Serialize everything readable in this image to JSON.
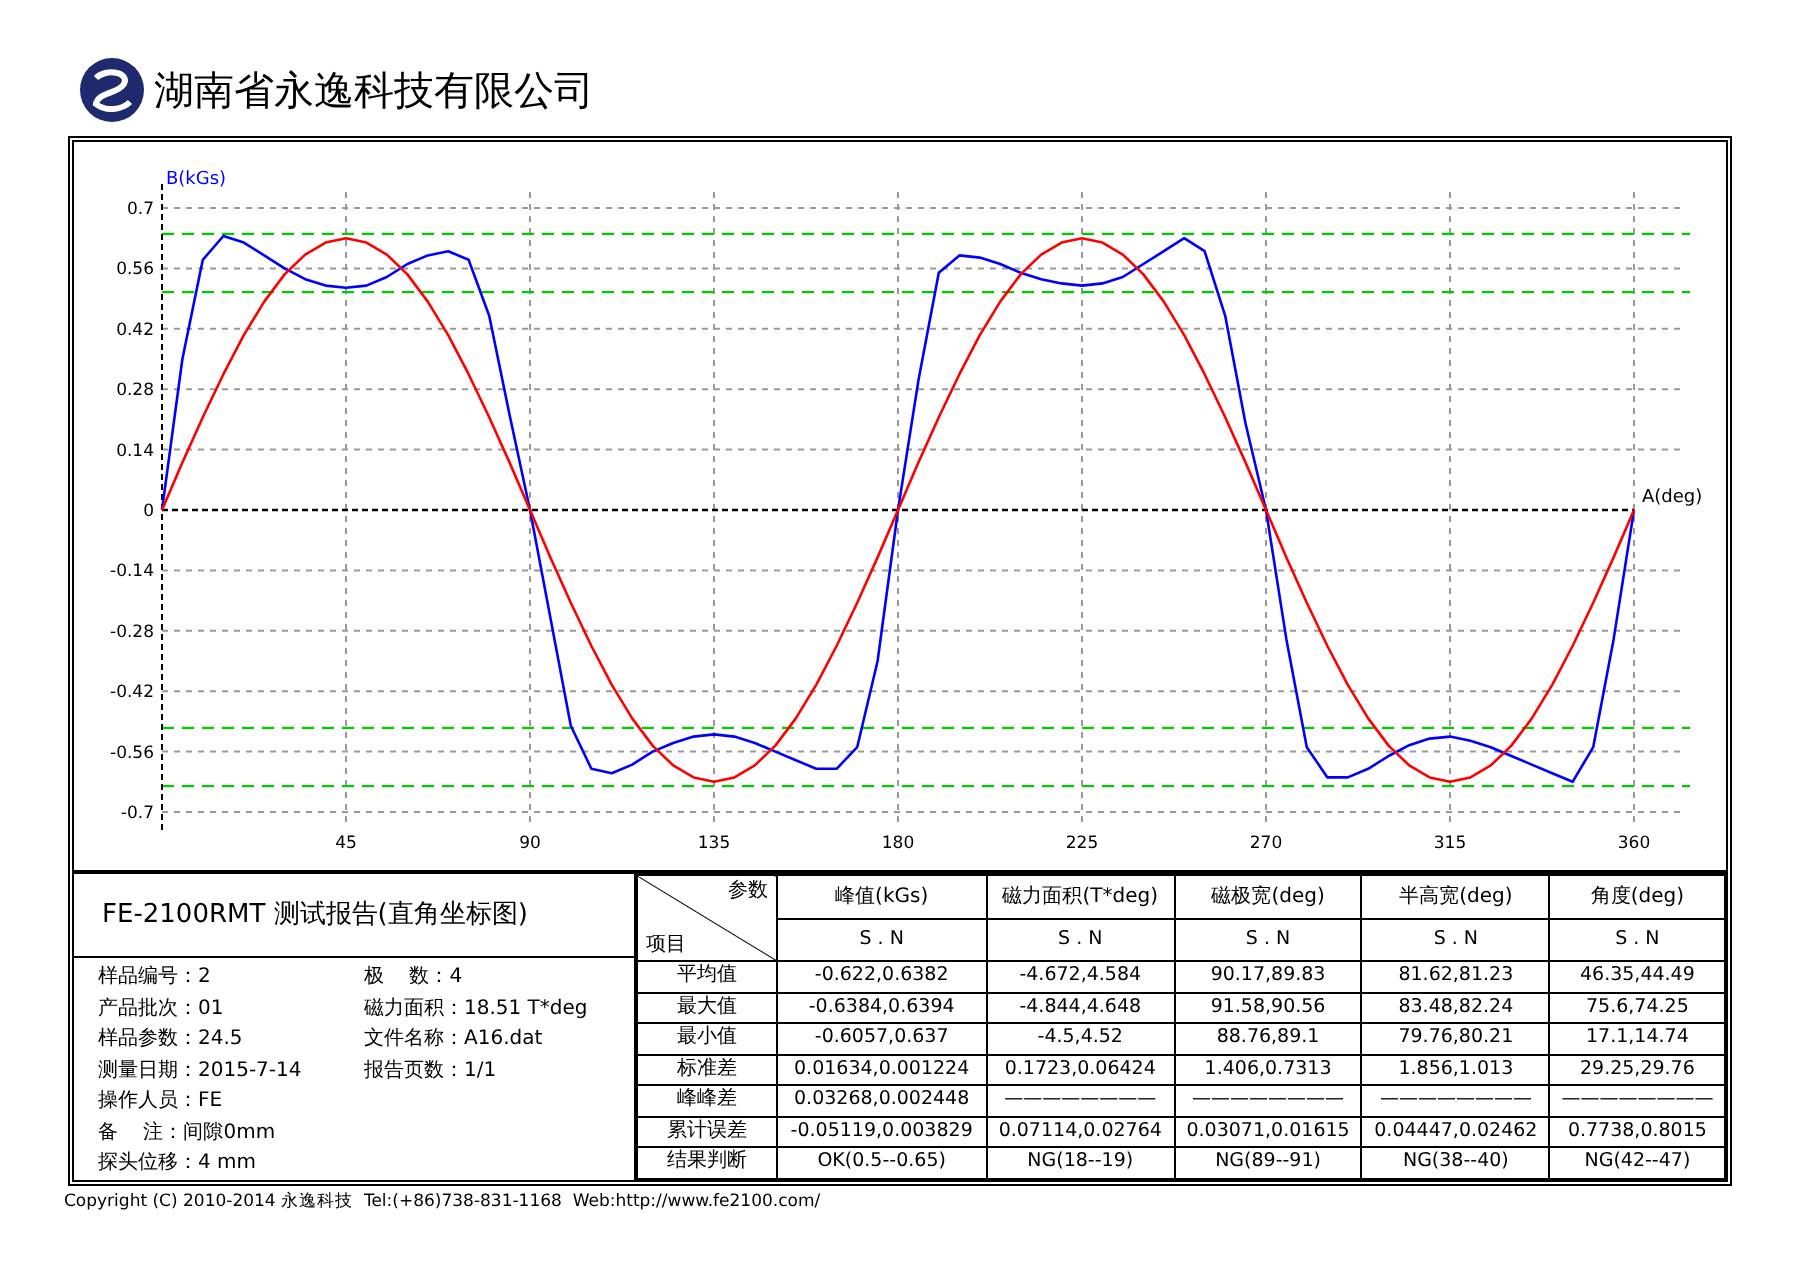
{
  "header": {
    "company": "湖南省永逸科技有限公司"
  },
  "chart": {
    "chart_data": {
      "type": "line",
      "ylabel": "B(kGs)",
      "xlabel": "A(deg)",
      "xlim": [
        0,
        360
      ],
      "ylim": [
        -0.7,
        0.7
      ],
      "xticks": [
        45,
        90,
        135,
        180,
        225,
        270,
        315,
        360
      ],
      "yticks": [
        0.7,
        0.56,
        0.42,
        0.28,
        0.14,
        0,
        -0.14,
        -0.28,
        -0.42,
        -0.56,
        -0.7
      ],
      "x": [
        0,
        5,
        10,
        15,
        20,
        25,
        30,
        35,
        40,
        45,
        50,
        55,
        60,
        65,
        70,
        75,
        80,
        85,
        90,
        95,
        100,
        105,
        110,
        115,
        120,
        125,
        130,
        135,
        140,
        145,
        150,
        155,
        160,
        165,
        170,
        175,
        180,
        185,
        190,
        195,
        200,
        205,
        210,
        215,
        220,
        225,
        230,
        235,
        240,
        245,
        250,
        255,
        260,
        265,
        270,
        275,
        280,
        285,
        290,
        295,
        300,
        305,
        310,
        315,
        320,
        325,
        330,
        335,
        340,
        345,
        350,
        355,
        360
      ],
      "series": [
        {
          "color": "#0000ff",
          "values": [
            0,
            0.35,
            0.58,
            0.635,
            0.62,
            0.59,
            0.56,
            0.535,
            0.52,
            0.515,
            0.52,
            0.54,
            0.57,
            0.59,
            0.6,
            0.58,
            0.45,
            0.22,
            0,
            -0.25,
            -0.5,
            -0.6,
            -0.61,
            -0.59,
            -0.56,
            -0.54,
            -0.525,
            -0.52,
            -0.525,
            -0.54,
            -0.56,
            -0.58,
            -0.6,
            -0.6,
            -0.55,
            -0.35,
            0,
            0.3,
            0.55,
            0.59,
            0.585,
            0.57,
            0.55,
            0.535,
            0.525,
            0.52,
            0.525,
            0.54,
            0.57,
            0.6,
            0.63,
            0.6,
            0.45,
            0.2,
            0,
            -0.3,
            -0.55,
            -0.62,
            -0.62,
            -0.6,
            -0.57,
            -0.545,
            -0.53,
            -0.525,
            -0.535,
            -0.55,
            -0.57,
            -0.59,
            -0.61,
            -0.63,
            -0.55,
            -0.3,
            0
          ]
        },
        {
          "color": "#ff0000",
          "values": [
            0,
            0.11,
            0.215,
            0.315,
            0.405,
            0.483,
            0.546,
            0.592,
            0.62,
            0.63,
            0.62,
            0.592,
            0.546,
            0.483,
            0.405,
            0.315,
            0.215,
            0.11,
            0,
            -0.11,
            -0.215,
            -0.315,
            -0.405,
            -0.483,
            -0.546,
            -0.592,
            -0.62,
            -0.63,
            -0.62,
            -0.592,
            -0.546,
            -0.483,
            -0.405,
            -0.315,
            -0.215,
            -0.11,
            0,
            0.11,
            0.215,
            0.315,
            0.405,
            0.483,
            0.546,
            0.592,
            0.62,
            0.63,
            0.62,
            0.592,
            0.546,
            0.483,
            0.405,
            0.315,
            0.215,
            0.11,
            0,
            -0.11,
            -0.215,
            -0.315,
            -0.405,
            -0.483,
            -0.546,
            -0.592,
            -0.62,
            -0.63,
            -0.62,
            -0.592,
            -0.546,
            -0.483,
            -0.405,
            -0.315,
            -0.215,
            -0.11,
            0
          ]
        }
      ],
      "grid": true,
      "ref_lines": [
        {
          "axis": "y",
          "value": 0.64,
          "color": "#00cc00"
        },
        {
          "axis": "y",
          "value": 0.505,
          "color": "#00cc00"
        },
        {
          "axis": "y",
          "value": -0.505,
          "color": "#00cc00"
        },
        {
          "axis": "y",
          "value": -0.64,
          "color": "#00cc00"
        },
        {
          "axis": "y",
          "value": 0,
          "color": "#000000"
        },
        {
          "axis": "x",
          "value": 0,
          "color": "#000000"
        }
      ]
    }
  },
  "report": {
    "title": "FE-2100RMT  测试报告(直角坐标图)",
    "left_info": [
      {
        "label": "样品编号：",
        "value": "2"
      },
      {
        "label": "产品批次：",
        "value": "01"
      },
      {
        "label": "样品参数：",
        "value": "24.5"
      },
      {
        "label": "测量日期：",
        "value": "2015-7-14"
      },
      {
        "label": "操作人员：",
        "value": "FE"
      },
      {
        "label": "备    注：",
        "value": "间隙0mm"
      },
      {
        "label": "探头位移：",
        "value": "4 mm"
      }
    ],
    "right_info": [
      {
        "label": "极    数：",
        "value": "4"
      },
      {
        "label": "磁力面积：",
        "value": "18.51 T*deg"
      },
      {
        "label": "文件名称：",
        "value": "A16.dat"
      },
      {
        "label": "报告页数：",
        "value": "1/1"
      }
    ]
  },
  "results": {
    "corner_top": "参数",
    "corner_bottom": "项目",
    "columns": [
      {
        "name": "峰值(kGs)",
        "sub": "S . N"
      },
      {
        "name": "磁力面积(T*deg)",
        "sub": "S . N"
      },
      {
        "name": "磁极宽(deg)",
        "sub": "S . N"
      },
      {
        "name": "半高宽(deg)",
        "sub": "S . N"
      },
      {
        "name": "角度(deg)",
        "sub": "S . N"
      }
    ],
    "rows": [
      {
        "label": "平均值",
        "cells": [
          "-0.622,0.6382",
          "-4.672,4.584",
          "90.17,89.83",
          "81.62,81.23",
          "46.35,44.49"
        ]
      },
      {
        "label": "最大值",
        "cells": [
          "-0.6384,0.6394",
          "-4.844,4.648",
          "91.58,90.56",
          "83.48,82.24",
          "75.6,74.25"
        ]
      },
      {
        "label": "最小值",
        "cells": [
          "-0.6057,0.637",
          "-4.5,4.52",
          "88.76,89.1",
          "79.76,80.21",
          "17.1,14.74"
        ]
      },
      {
        "label": "标准差",
        "cells": [
          "0.01634,0.001224",
          "0.1723,0.06424",
          "1.406,0.7313",
          "1.856,1.013",
          "29.25,29.76"
        ]
      },
      {
        "label": "峰峰差",
        "cells": [
          "0.03268,0.002448",
          "————————",
          "————————",
          "————————",
          "————————"
        ]
      },
      {
        "label": "累计误差",
        "cells": [
          "-0.05119,0.003829",
          "0.07114,0.02764",
          "0.03071,0.01615",
          "0.04447,0.02462",
          "0.7738,0.8015"
        ]
      },
      {
        "label": "结果判断",
        "cells": [
          "OK(0.5--0.65)",
          "NG(18--19)",
          "NG(89--91)",
          "NG(38--40)",
          "NG(42--47)"
        ]
      }
    ]
  },
  "footer": "Copyright (C) 2010-2014 永逸科技  Tel:(+86)738-831-1168  Web:http://www.fe2100.com/"
}
